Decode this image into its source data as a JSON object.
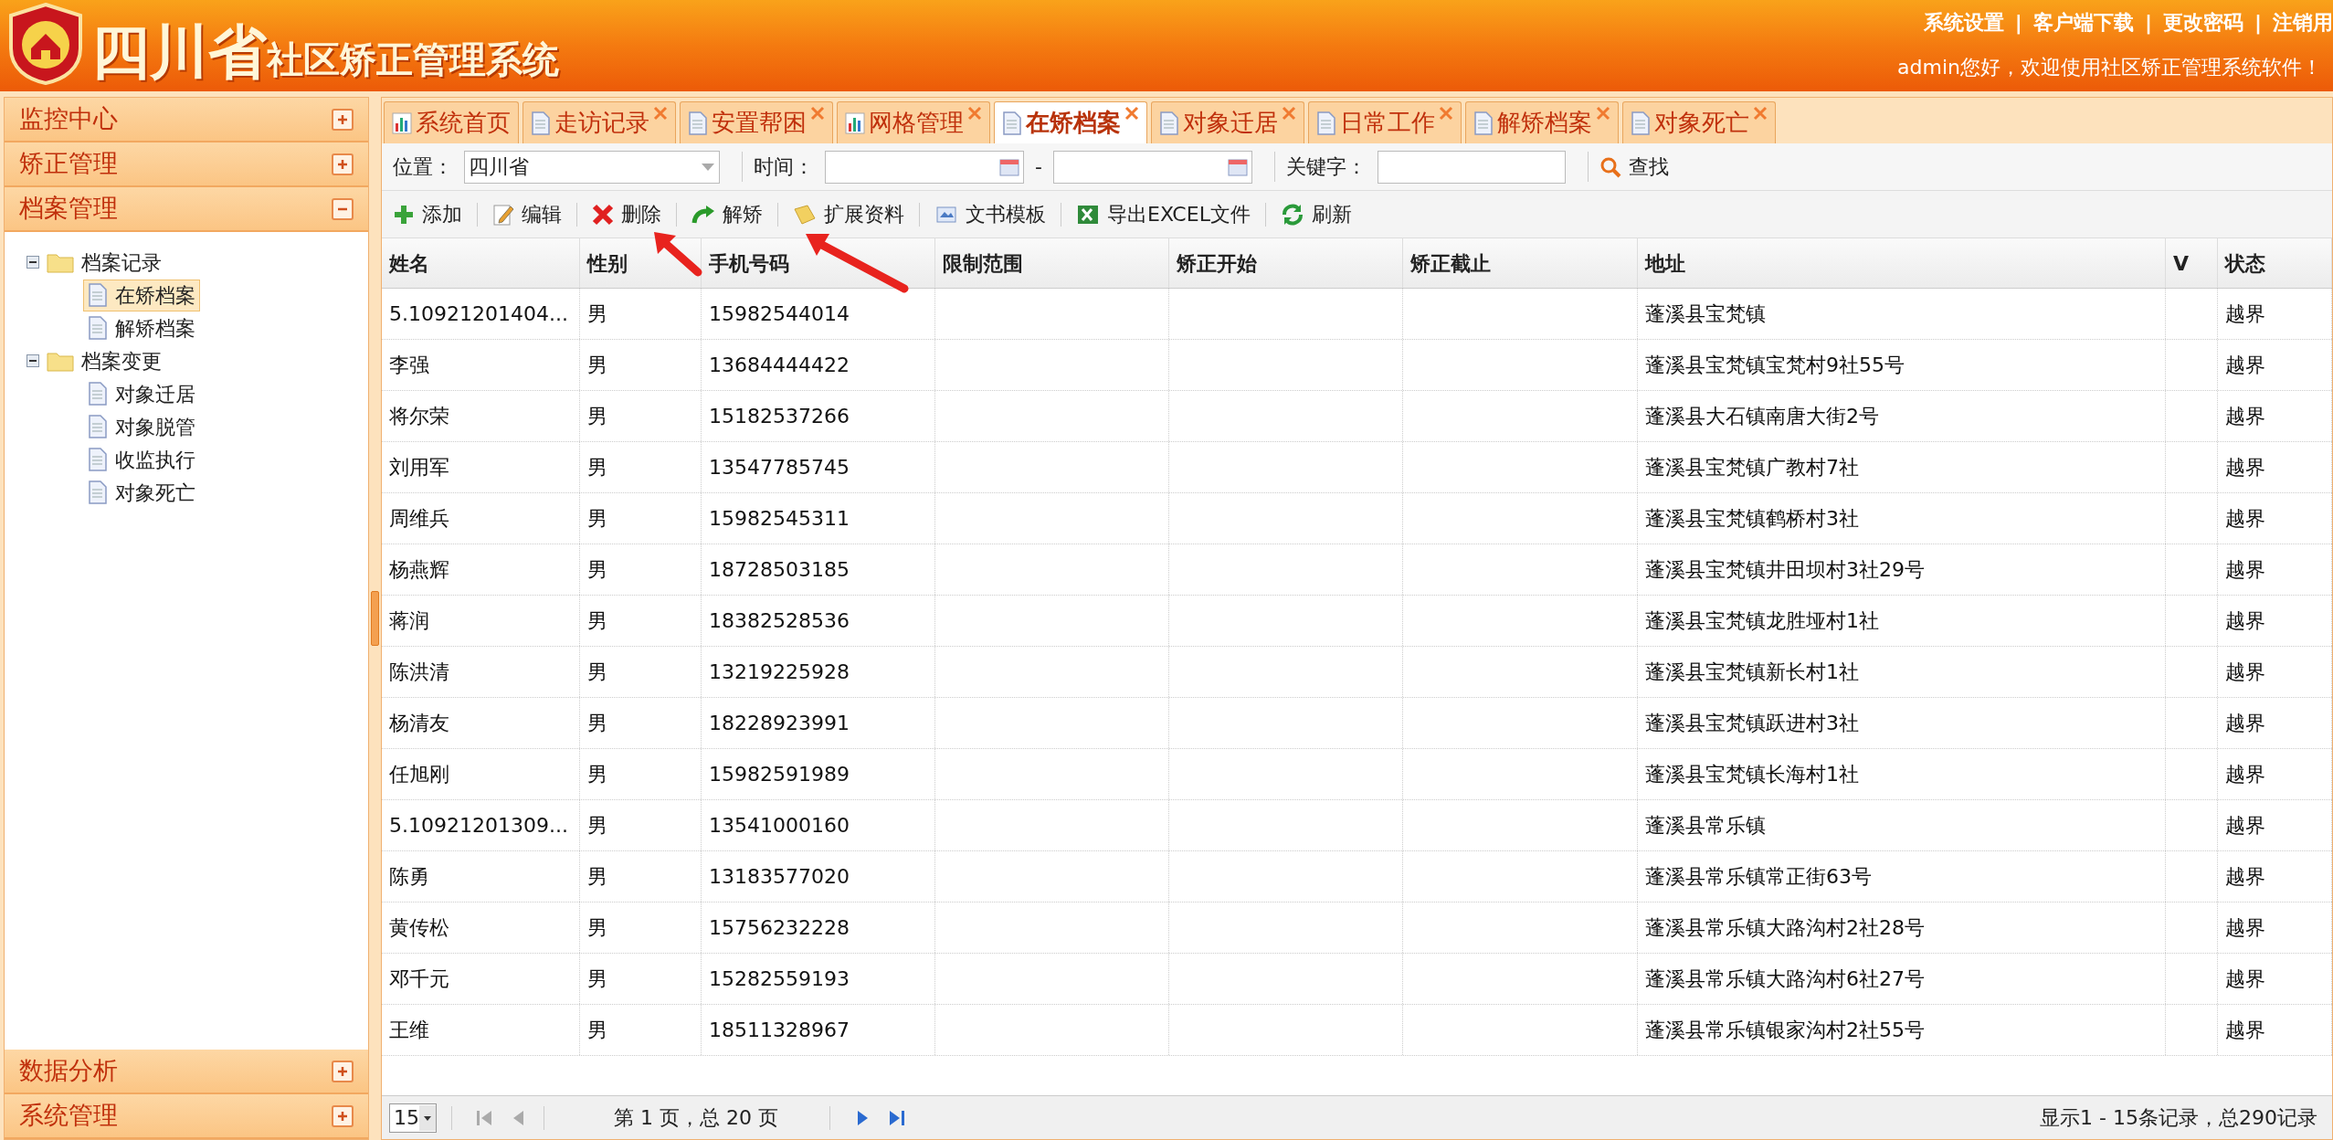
{
  "header": {
    "title_big": "四川省",
    "title_small": "社区矫正管理系统",
    "links": [
      "系统设置",
      "客户端下载",
      "更改密码",
      "注销用"
    ],
    "link_separator": "|",
    "greeting": "admin您好，欢迎使用社区矫正管理系统软件！"
  },
  "sidebar": {
    "sections": [
      {
        "label": "监控中心",
        "expanded": false
      },
      {
        "label": "矫正管理",
        "expanded": false
      },
      {
        "label": "档案管理",
        "expanded": true,
        "tree": [
          {
            "label": "档案记录",
            "expanded": true,
            "children": [
              {
                "label": "在矫档案",
                "selected": true
              },
              {
                "label": "解矫档案",
                "selected": false
              }
            ]
          },
          {
            "label": "档案变更",
            "expanded": true,
            "children": [
              {
                "label": "对象迁居",
                "selected": false
              },
              {
                "label": "对象脱管",
                "selected": false
              },
              {
                "label": "收监执行",
                "selected": false
              },
              {
                "label": "对象死亡",
                "selected": false
              }
            ]
          }
        ]
      },
      {
        "label": "数据分析",
        "expanded": false
      },
      {
        "label": "系统管理",
        "expanded": false
      }
    ]
  },
  "tabs": [
    {
      "label": "系统首页",
      "kind": "chart",
      "closable": false,
      "selected": false
    },
    {
      "label": "走访记录",
      "kind": "doc",
      "closable": true,
      "selected": false
    },
    {
      "label": "安置帮困",
      "kind": "doc",
      "closable": true,
      "selected": false
    },
    {
      "label": "网格管理",
      "kind": "chart",
      "closable": true,
      "selected": false
    },
    {
      "label": "在矫档案",
      "kind": "doc",
      "closable": true,
      "selected": true
    },
    {
      "label": "对象迁居",
      "kind": "doc",
      "closable": true,
      "selected": false
    },
    {
      "label": "日常工作",
      "kind": "doc",
      "closable": true,
      "selected": false
    },
    {
      "label": "解矫档案",
      "kind": "doc",
      "closable": true,
      "selected": false
    },
    {
      "label": "对象死亡",
      "kind": "doc",
      "closable": true,
      "selected": false
    }
  ],
  "filters": {
    "location_label": "位置：",
    "location_value": "四川省",
    "time_label": "时间：",
    "time_separator": "-",
    "keyword_label": "关键字：",
    "search_button": "查找"
  },
  "toolbar": [
    {
      "label": "添加",
      "kind": "add"
    },
    {
      "label": "编辑",
      "kind": "edit"
    },
    {
      "label": "删除",
      "kind": "delete"
    },
    {
      "label": "解矫",
      "kind": "release"
    },
    {
      "label": "扩展资料",
      "kind": "folder"
    },
    {
      "label": "文书模板",
      "kind": "template"
    },
    {
      "label": "导出EXCEL文件",
      "kind": "excel"
    },
    {
      "label": "刷新",
      "kind": "refresh"
    }
  ],
  "table": {
    "columns": [
      "姓名",
      "性别",
      "手机号码",
      "限制范围",
      "矫正开始",
      "矫正截止",
      "地址",
      "V",
      "状态"
    ],
    "rows": [
      [
        "5.10921201404...",
        "男",
        "15982544014",
        "",
        "",
        "",
        "蓬溪县宝梵镇",
        "",
        "越界"
      ],
      [
        "李强",
        "男",
        "13684444422",
        "",
        "",
        "",
        "蓬溪县宝梵镇宝梵村9社55号",
        "",
        "越界"
      ],
      [
        "将尔荣",
        "男",
        "15182537266",
        "",
        "",
        "",
        "蓬溪县大石镇南唐大街2号",
        "",
        "越界"
      ],
      [
        "刘用军",
        "男",
        "13547785745",
        "",
        "",
        "",
        "蓬溪县宝梵镇广教村7社",
        "",
        "越界"
      ],
      [
        "周维兵",
        "男",
        "15982545311",
        "",
        "",
        "",
        "蓬溪县宝梵镇鹤桥村3社",
        "",
        "越界"
      ],
      [
        "杨燕辉",
        "男",
        "18728503185",
        "",
        "",
        "",
        "蓬溪县宝梵镇井田坝村3社29号",
        "",
        "越界"
      ],
      [
        "蒋润",
        "男",
        "18382528536",
        "",
        "",
        "",
        "蓬溪县宝梵镇龙胜垭村1社",
        "",
        "越界"
      ],
      [
        "陈洪清",
        "男",
        "13219225928",
        "",
        "",
        "",
        "蓬溪县宝梵镇新长村1社",
        "",
        "越界"
      ],
      [
        "杨清友",
        "男",
        "18228923991",
        "",
        "",
        "",
        "蓬溪县宝梵镇跃进村3社",
        "",
        "越界"
      ],
      [
        "任旭刚",
        "男",
        "15982591989",
        "",
        "",
        "",
        "蓬溪县宝梵镇长海村1社",
        "",
        "越界"
      ],
      [
        "5.10921201309...",
        "男",
        "13541000160",
        "",
        "",
        "",
        "蓬溪县常乐镇",
        "",
        "越界"
      ],
      [
        "陈勇",
        "男",
        "13183577020",
        "",
        "",
        "",
        "蓬溪县常乐镇常正街63号",
        "",
        "越界"
      ],
      [
        "黄传松",
        "男",
        "15756232228",
        "",
        "",
        "",
        "蓬溪县常乐镇大路沟村2社28号",
        "",
        "越界"
      ],
      [
        "邓千元",
        "男",
        "15282559193",
        "",
        "",
        "",
        "蓬溪县常乐镇大路沟村6社27号",
        "",
        "越界"
      ],
      [
        "王维",
        "男",
        "18511328967",
        "",
        "",
        "",
        "蓬溪县常乐镇银家沟村2社55号",
        "",
        "越界"
      ]
    ]
  },
  "pager": {
    "page_size": "15",
    "page_info": "第 1 页，总 20 页",
    "summary": "显示1 - 15条记录，总290记录"
  },
  "annotations": [
    {
      "kind": "arrow"
    },
    {
      "kind": "arrow"
    }
  ]
}
